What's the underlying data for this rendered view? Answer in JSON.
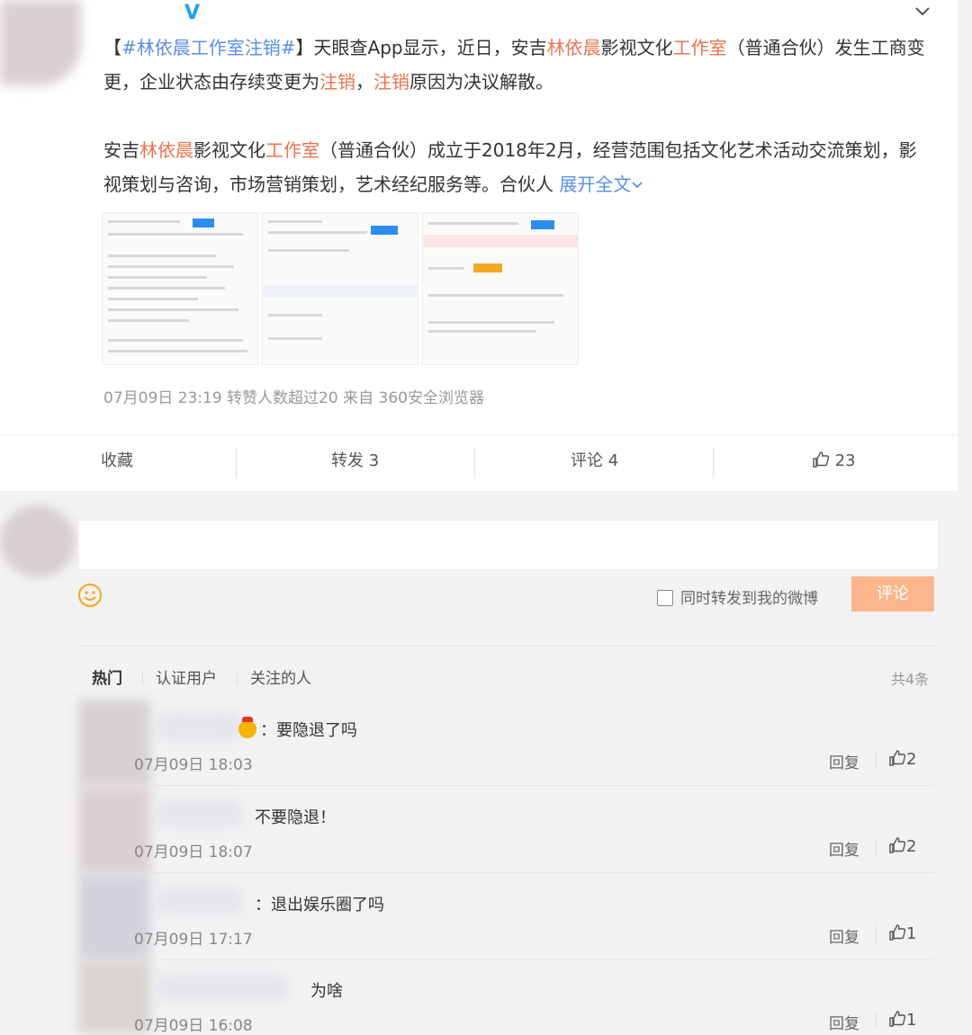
{
  "post": {
    "p1_open": "【",
    "p1_topic": "#林依晨工作室注销#",
    "p1_close": "】天眼查App显示，近日，安吉",
    "p1_name": "林依晨",
    "p1_mid": "影视文化",
    "p1_studio": "工作室",
    "p1_rest": "（普通合伙）发生工商变更，企业状态由存续变更为",
    "p1_cancel": "注销",
    "p1_comma": "，",
    "p1_cancel2": "注销",
    "p1_end": "原因为决议解散。",
    "p2_start": "安吉",
    "p2_name": "林依晨",
    "p2_mid": "影视文化",
    "p2_studio": "工作室",
    "p2_rest": "（普通合伙）成立于2018年2月，经营范围包括文化艺术活动交流策划，影视策划与咨询，市场营销策划，艺术经纪服务等。合伙人",
    "expand_label": "展开全文",
    "meta": "07月09日 23:19 转赞人数超过20  来自 360安全浏览器"
  },
  "actions": {
    "favorite": "收藏",
    "repost": "转发 3",
    "comment": "评论 4",
    "like_count": "23"
  },
  "composer": {
    "repost_option": "同时转发到我的微博",
    "submit": "评论"
  },
  "filters": {
    "hot": "热门",
    "verified": "认证用户",
    "following": "关注的人",
    "total": "共4条"
  },
  "comments": [
    {
      "text": "：要隐退了吗",
      "time": "07月09日 18:03",
      "reply": "回复",
      "likes": "2"
    },
    {
      "text": "不要隐退！",
      "time": "07月09日 18:07",
      "reply": "回复",
      "likes": "2"
    },
    {
      "text": "：退出娱乐圈了吗",
      "time": "07月09日 17:17",
      "reply": "回复",
      "likes": "1"
    },
    {
      "text": "为啥",
      "time": "07月09日 16:08",
      "reply": "回复",
      "likes": "1"
    }
  ],
  "colors": {
    "accent_orange": "#eb7350",
    "link_blue": "#5a8fe6",
    "submit_bg": "#fbb68c"
  }
}
